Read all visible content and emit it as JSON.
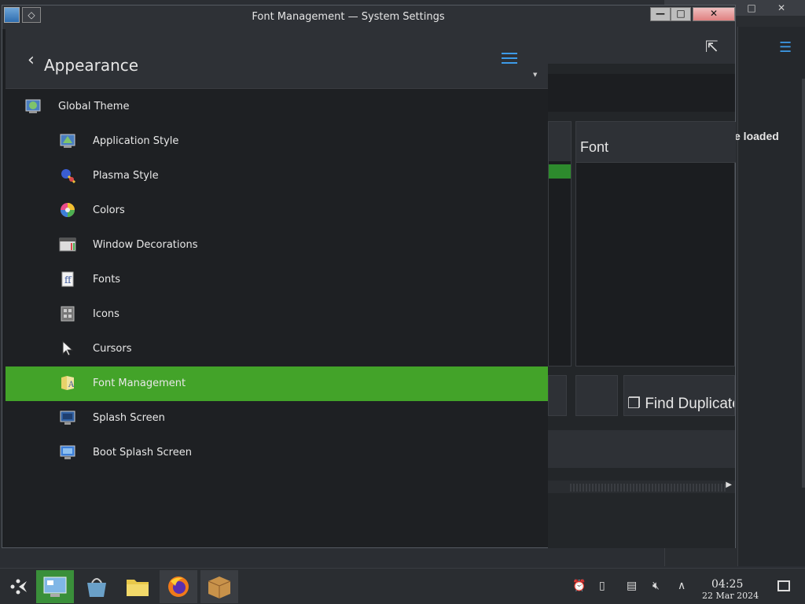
{
  "window": {
    "title": "Font Management — System Settings",
    "minimize_label": "—",
    "maximize_label": "□",
    "close_label": "✕"
  },
  "sidebar": {
    "back_label": "‹",
    "title": "Appearance",
    "items": [
      {
        "label": "Global Theme",
        "icon": "global-theme-icon"
      },
      {
        "label": "Application Style",
        "icon": "application-style-icon"
      },
      {
        "label": "Plasma Style",
        "icon": "plasma-style-icon"
      },
      {
        "label": "Colors",
        "icon": "colors-icon"
      },
      {
        "label": "Window Decorations",
        "icon": "window-decorations-icon"
      },
      {
        "label": "Fonts",
        "icon": "fonts-icon"
      },
      {
        "label": "Icons",
        "icon": "icons-icon"
      },
      {
        "label": "Cursors",
        "icon": "cursor-icon"
      },
      {
        "label": "Font Management",
        "icon": "font-management-icon",
        "selected": true
      },
      {
        "label": "Splash Screen",
        "icon": "splash-screen-icon"
      },
      {
        "label": "Boot Splash Screen",
        "icon": "boot-splash-icon"
      }
    ]
  },
  "content": {
    "font_column_header": "Font",
    "find_duplicates_label": "Find Duplicate"
  },
  "background_window": {
    "partial_text": "e loaded",
    "maximize_label": "□",
    "close_label": "✕"
  },
  "taskbar": {
    "time": "04:25",
    "date": "22 Mar 2024"
  },
  "colors": {
    "selection": "#43a329",
    "accent": "#3d9be9"
  }
}
